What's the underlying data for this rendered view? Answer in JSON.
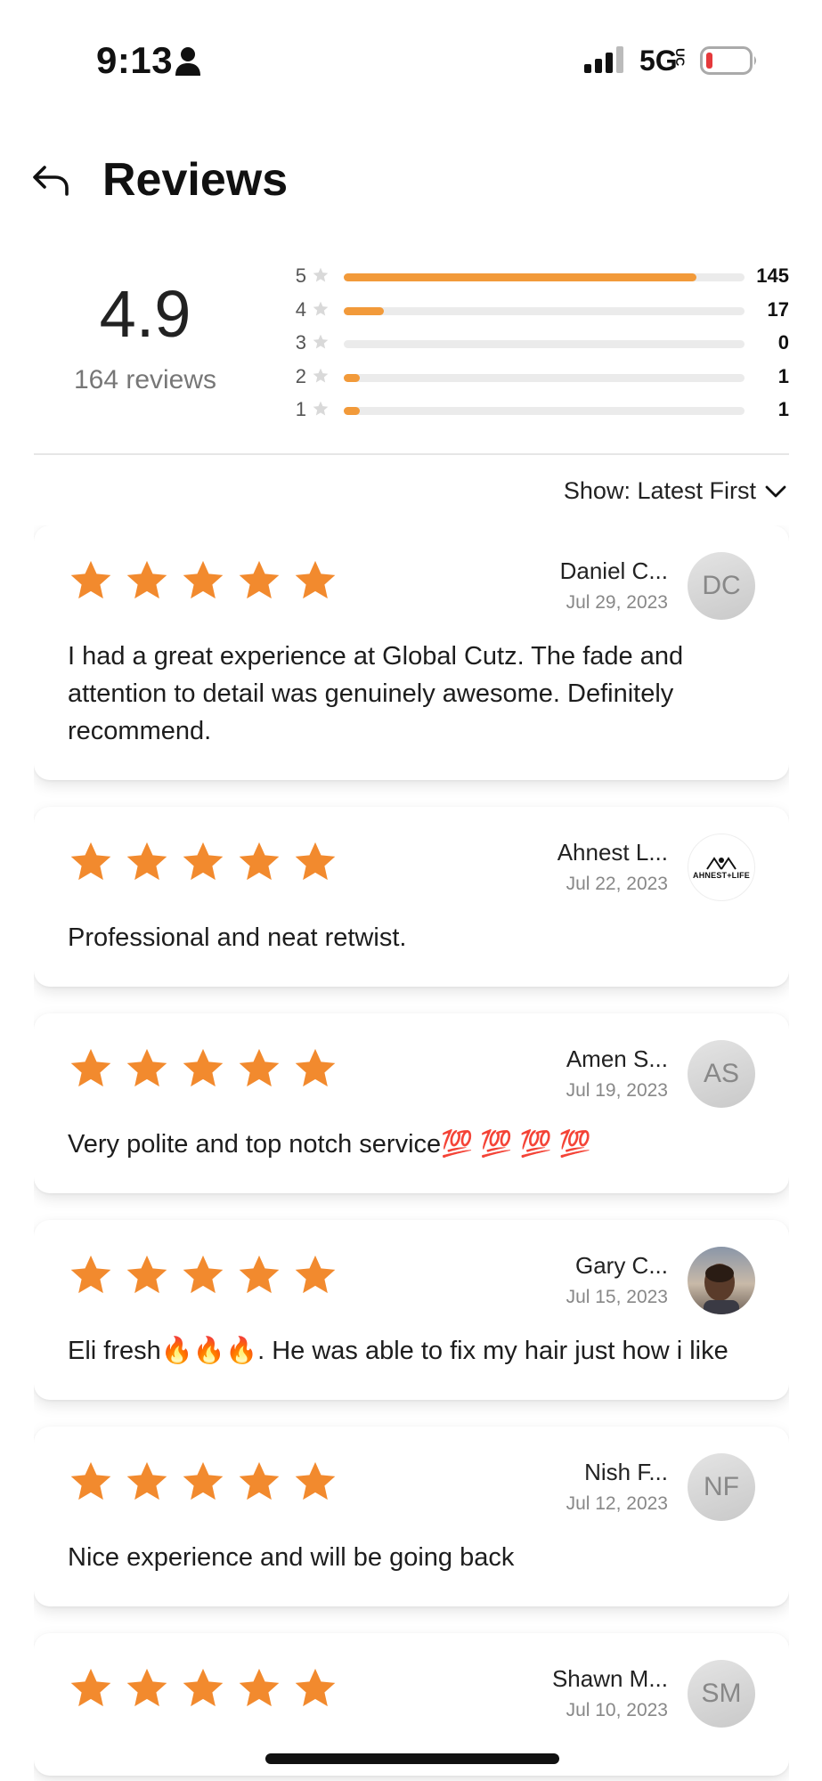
{
  "status_bar": {
    "time": "9:13",
    "network": "5G",
    "network_sub": "UC",
    "icons": [
      "person-icon",
      "signal-icon",
      "battery-icon"
    ]
  },
  "header": {
    "title": "Reviews",
    "back_icon": "back-arrow-icon"
  },
  "summary": {
    "average": "4.9",
    "count_label": "164 reviews",
    "distribution": [
      {
        "stars": "5",
        "count": "145",
        "fraction": 0.88
      },
      {
        "stars": "4",
        "count": "17",
        "fraction": 0.1
      },
      {
        "stars": "3",
        "count": "0",
        "fraction": 0
      },
      {
        "stars": "2",
        "count": "1",
        "fraction": 0.04
      },
      {
        "stars": "1",
        "count": "1",
        "fraction": 0.04
      }
    ]
  },
  "sort": {
    "label": "Show: Latest First"
  },
  "colors": {
    "accent": "#f29a3a",
    "star": "#f28a2e",
    "track": "#ebebeb"
  },
  "reviews": [
    {
      "rating": 5,
      "name": "Daniel C...",
      "date": "Jul 29, 2023",
      "initials": "DC",
      "avatar_type": "initials",
      "text": "I had a great experience at Global Cutz. The fade and attention to detail was genuinely awesome. Definitely recommend."
    },
    {
      "rating": 5,
      "name": "Ahnest L...",
      "date": "Jul 22, 2023",
      "initials": "",
      "avatar_type": "logo",
      "logo_text": "AHNEST+LIFE",
      "text": "Professional and neat retwist."
    },
    {
      "rating": 5,
      "name": "Amen S...",
      "date": "Jul 19, 2023",
      "initials": "AS",
      "avatar_type": "initials",
      "text": "Very polite and top notch service💯 💯 💯 💯"
    },
    {
      "rating": 5,
      "name": "Gary C...",
      "date": "Jul 15, 2023",
      "initials": "",
      "avatar_type": "photo",
      "text": "Eli fresh🔥🔥🔥. He was able to fix my hair just how i like"
    },
    {
      "rating": 5,
      "name": "Nish F...",
      "date": "Jul 12, 2023",
      "initials": "NF",
      "avatar_type": "initials",
      "text": "Nice experience and will be going back"
    },
    {
      "rating": 5,
      "name": "Shawn M...",
      "date": "Jul 10, 2023",
      "initials": "SM",
      "avatar_type": "initials",
      "text": ""
    }
  ]
}
